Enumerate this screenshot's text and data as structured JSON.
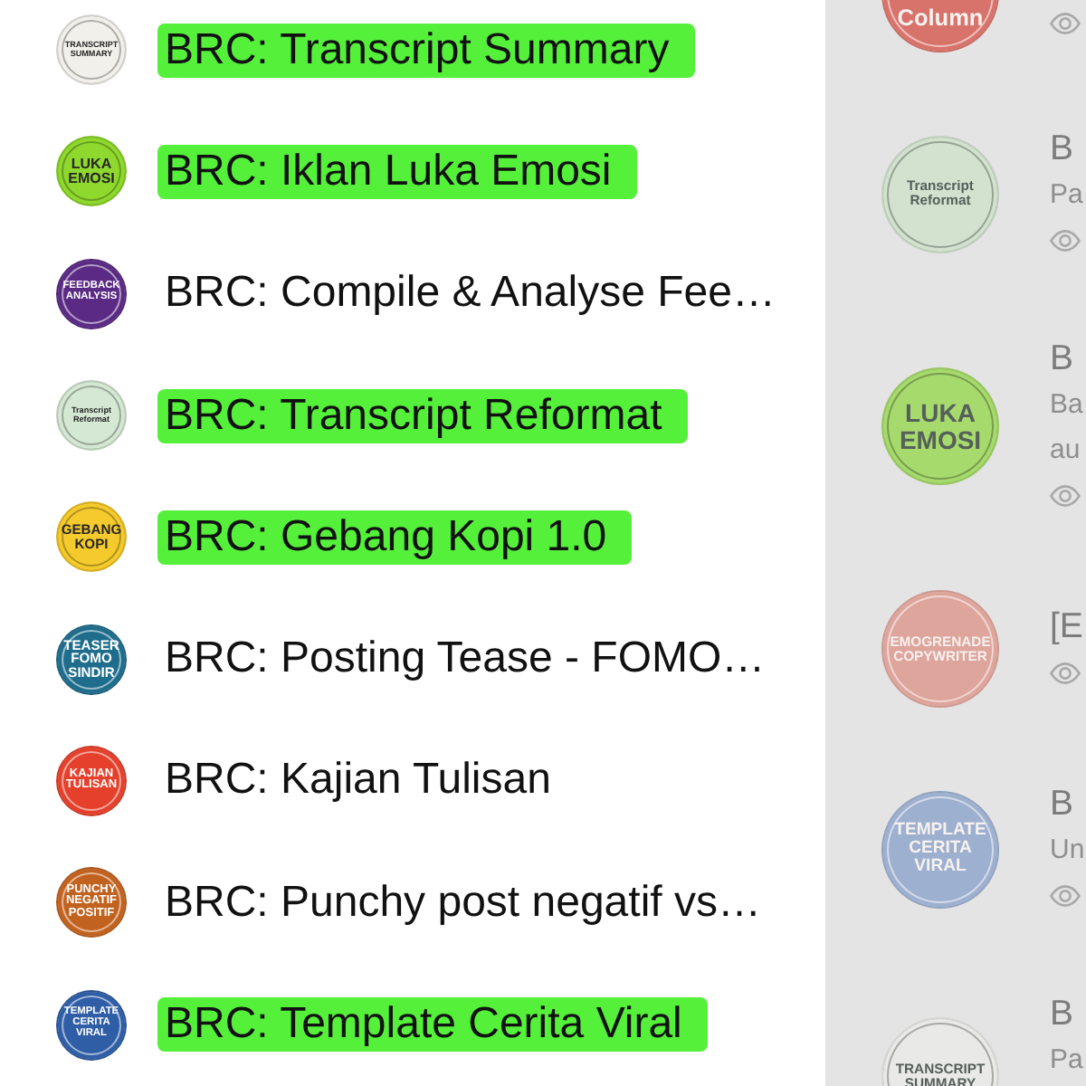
{
  "sidebar": {
    "items": [
      {
        "name": "BRC: Transcript Summary",
        "logo": "TRANSCRIPT\nSUMMARY",
        "color": "#f2f0eb",
        "highlighted": true
      },
      {
        "name": "BRC: Iklan Luka Emosi",
        "logo": "LUKA\nEMOSI",
        "color": "#8fd92e",
        "highlighted": true
      },
      {
        "name": "BRC: Compile & Analyse Fee…",
        "logo": "FEEDBACK\nANALYSIS",
        "color": "#5a2a84",
        "highlighted": false
      },
      {
        "name": "BRC: Transcript Reformat",
        "logo": "Transcript\nReformat",
        "color": "#d5e8d3",
        "highlighted": true
      },
      {
        "name": "BRC: Gebang Kopi 1.0",
        "logo": "GEBANG\nKOPI",
        "color": "#f5ca2c",
        "highlighted": true
      },
      {
        "name": "BRC: Posting Tease - FOMO…",
        "logo": "TEASER\nFOMO\nSINDIR",
        "color": "#1f6d8c",
        "highlighted": false
      },
      {
        "name": "BRC: Kajian Tulisan",
        "logo": "KAJIAN\nTULISAN",
        "color": "#e5402b",
        "highlighted": false
      },
      {
        "name": "BRC: Punchy post negatif vs…",
        "logo": "PUNCHY\nNEGATIF\nPOSITIF",
        "color": "#c2621f",
        "highlighted": false
      },
      {
        "name": "BRC: Template Cerita Viral",
        "logo": "TEMPLATE\nCERITA\nVIRAL",
        "color": "#2f5ea6",
        "highlighted": true
      }
    ]
  },
  "main_panel": {
    "cards": [
      {
        "logo": "Column",
        "color": "#d8736b",
        "eye": true
      },
      {
        "title": "B",
        "description": "Pa",
        "logo": "Transcript\nReformat",
        "color": "#d2e2cf",
        "eye": true
      },
      {
        "title": "B",
        "description": "Ba\nau",
        "logo": "LUKA\nEMOSI",
        "color": "#a6da6c",
        "eye": true
      },
      {
        "title": "[E",
        "logo": "EMOGRENADE\nCOPYWRITER",
        "color": "#dea59c",
        "eye": true
      },
      {
        "title": "B",
        "description": "Un",
        "logo": "TEMPLATE\nCERITA\nVIRAL",
        "color": "#9db0cf",
        "eye": true
      },
      {
        "title": "B",
        "description": "Pa",
        "logo": "TRANSCRIPT\nSUMMARY",
        "color": "#e9e9e7",
        "eye": false
      }
    ]
  }
}
